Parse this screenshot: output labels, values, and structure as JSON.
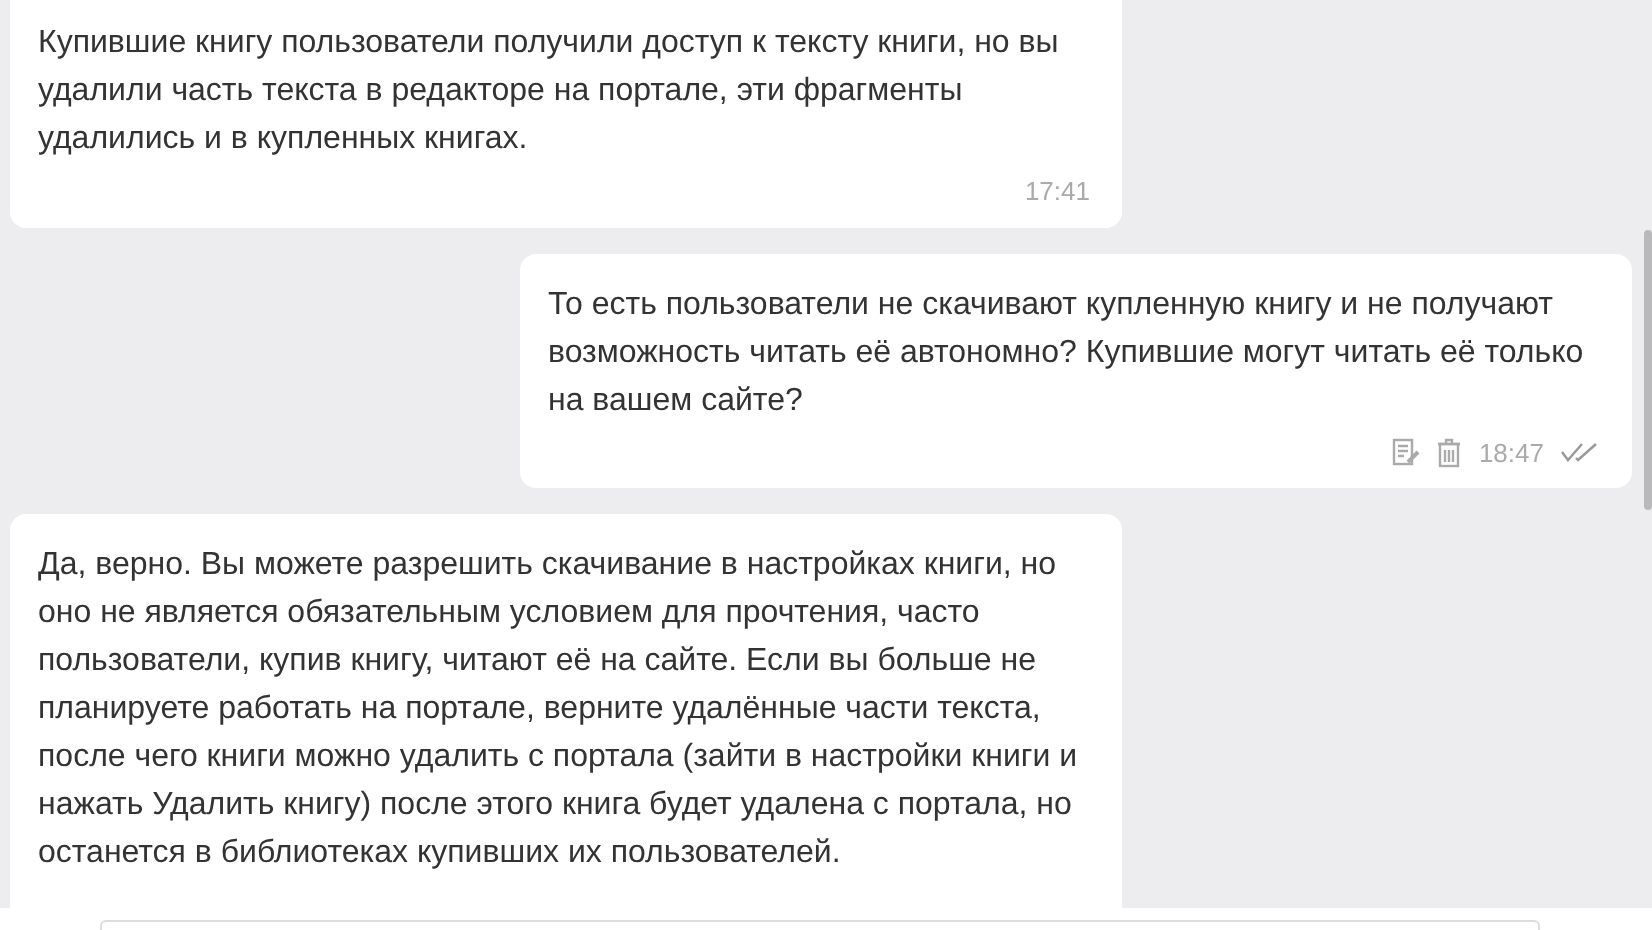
{
  "messages": [
    {
      "kind": "incoming",
      "text": "Купившие книгу пользователи получили доступ к тексту книги, но вы удалили часть текста в редакторе на портале, эти фрагменты удалились и в купленных книгах.",
      "time": "17:41"
    },
    {
      "kind": "outgoing",
      "text": "То есть пользователи не скачивают купленную книгу и не получают возможность читать её автономно? Купившие могут читать её только на вашем сайте?",
      "time": "18:47",
      "read": true
    },
    {
      "kind": "incoming",
      "text": "Да, верно. Вы можете разрешить скачивание в настройках книги, но оно не является обязательным условием для прочтения, часто пользователи, купив книгу, читают её на сайте. Если вы больше не планируете работать на портале, верните удалённые части текста, после чего книги можно удалить с портала (зайти в настройки книги и нажать Удалить книгу) после этого книга будет удалена с портала, но останется в библиотеках купивших их пользователей."
    }
  ]
}
